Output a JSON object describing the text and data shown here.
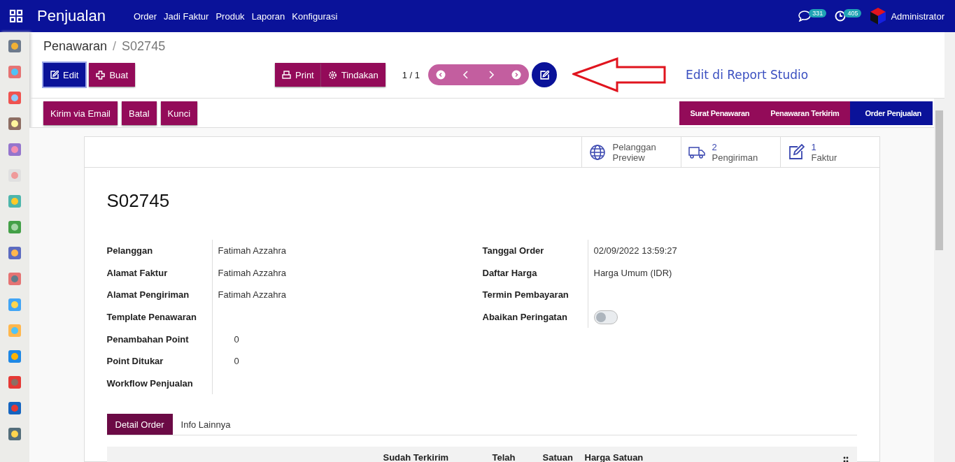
{
  "navbar": {
    "app_title": "Penjualan",
    "menu": [
      "Order",
      "Jadi Faktur",
      "Produk",
      "Laporan",
      "Konfigurasi"
    ],
    "chat_count": "331",
    "activity_count": "405",
    "user": "Administrator"
  },
  "breadcrumb": {
    "separator": "/",
    "items": [
      {
        "label": "Penawaran",
        "selected": false
      },
      {
        "label": "S02745",
        "selected": true
      }
    ]
  },
  "buttons": {
    "edit": "Edit",
    "create": "Buat",
    "print": "Print",
    "actions": "Tindakan"
  },
  "pager": "1 / 1",
  "annotation": "Edit di Report Studio",
  "header_buttons": [
    "Kirim via Email",
    "Batal",
    "Kunci"
  ],
  "statusbar": [
    {
      "label": "Surat Penawaran",
      "selected": false
    },
    {
      "label": "Penawaran Terkirim",
      "selected": false
    },
    {
      "label": "Order Penjualan",
      "selected": true
    }
  ],
  "smart_buttons": [
    {
      "kind": "globe",
      "title": "Pelanggan",
      "label": "Preview"
    },
    {
      "kind": "truck",
      "count": "2",
      "label": "Pengiriman"
    },
    {
      "kind": "edit",
      "count": "1",
      "label": "Faktur"
    }
  ],
  "title": "S02745",
  "left_fields": [
    {
      "label": "Pelanggan",
      "value": "Fatimah Azzahra",
      "kind": "text"
    },
    {
      "label": "Alamat Faktur",
      "value": "Fatimah Azzahra",
      "kind": "text"
    },
    {
      "label": "Alamat Pengiriman",
      "value": "Fatimah Azzahra",
      "kind": "text"
    },
    {
      "label": "Template Penawaran",
      "kind": "text"
    },
    {
      "label": "Penambahan Point",
      "value": "0",
      "kind": "number"
    },
    {
      "label": "Point Ditukar",
      "value": "0",
      "kind": "number"
    },
    {
      "label": "Workflow Penjualan",
      "kind": "text"
    }
  ],
  "right_fields": [
    {
      "label": "Tanggal Order",
      "value": "02/09/2022 13:59:27",
      "kind": "text"
    },
    {
      "label": "Daftar Harga",
      "value": "Harga Umum (IDR)",
      "kind": "text"
    },
    {
      "label": "Termin Pembayaran",
      "kind": "text"
    },
    {
      "label": "Abaikan Peringatan",
      "kind": "toggle",
      "on": false
    }
  ],
  "tabs": [
    {
      "label": "Detail Order",
      "selected": true
    },
    {
      "label": "Info Lainnya",
      "selected": false
    }
  ],
  "table": {
    "columns": [
      "Sudah Terkirim",
      "Telah",
      "Satuan",
      "Harga Satuan"
    ]
  }
}
